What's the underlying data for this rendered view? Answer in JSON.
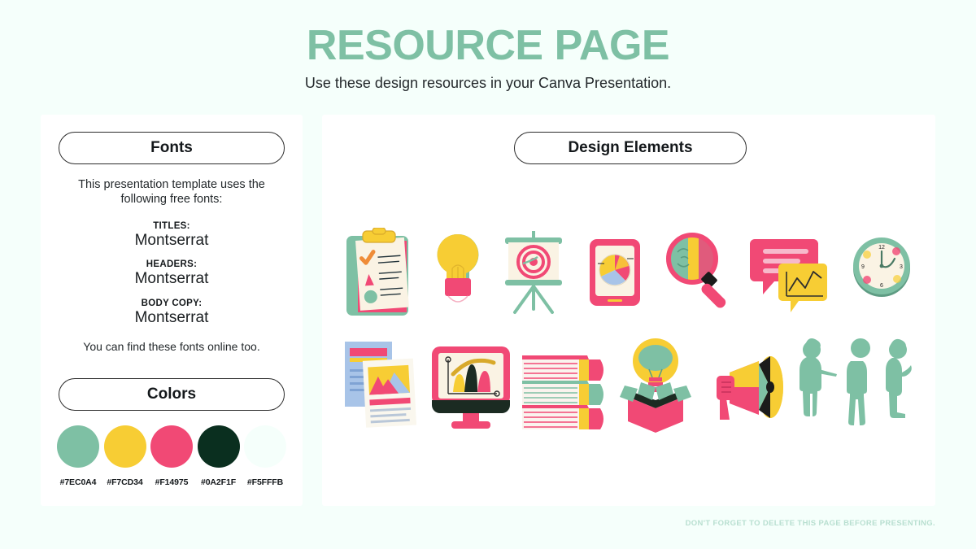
{
  "header": {
    "title": "RESOURCE PAGE",
    "subtitle": "Use these design resources in your Canva Presentation."
  },
  "fonts_panel": {
    "pill_label": "Fonts",
    "intro": "This presentation template uses the following free fonts:",
    "rows": [
      {
        "label": "TITLES:",
        "value": "Montserrat"
      },
      {
        "label": "HEADERS:",
        "value": "Montserrat"
      },
      {
        "label": "BODY COPY:",
        "value": "Montserrat"
      }
    ],
    "outro": "You can find these fonts online too."
  },
  "colors_panel": {
    "pill_label": "Colors",
    "swatches": [
      {
        "hex": "#7EC0A4",
        "name": "mint-green"
      },
      {
        "hex": "#F7CD34",
        "name": "yellow"
      },
      {
        "hex": "#F14975",
        "name": "pink"
      },
      {
        "hex": "#0A2F1F",
        "name": "dark-green"
      },
      {
        "hex": "#F5FFFB",
        "name": "off-white"
      }
    ]
  },
  "design_panel": {
    "pill_label": "Design Elements",
    "row1": [
      "clipboard-checklist-icon",
      "lightbulb-icon",
      "target-presentation-board-icon",
      "tablet-pie-chart-icon",
      "magnifier-brain-icon",
      "speech-bubbles-chart-icon",
      "clock-icon"
    ],
    "row2": [
      "documents-report-icon",
      "monitor-chart-icon",
      "stacked-books-icon",
      "lightbulb-in-box-icon",
      "megaphone-icon",
      "people-silhouettes-icon"
    ]
  },
  "footer": {
    "note": "DON'T FORGET TO DELETE THIS PAGE BEFORE PRESENTING."
  },
  "palette": {
    "background": "#F5FFFB",
    "title_green": "#7EC0A4",
    "panel_white": "#FFFFFF",
    "ink": "#14181B",
    "footer_green": "#B8DFD0"
  }
}
